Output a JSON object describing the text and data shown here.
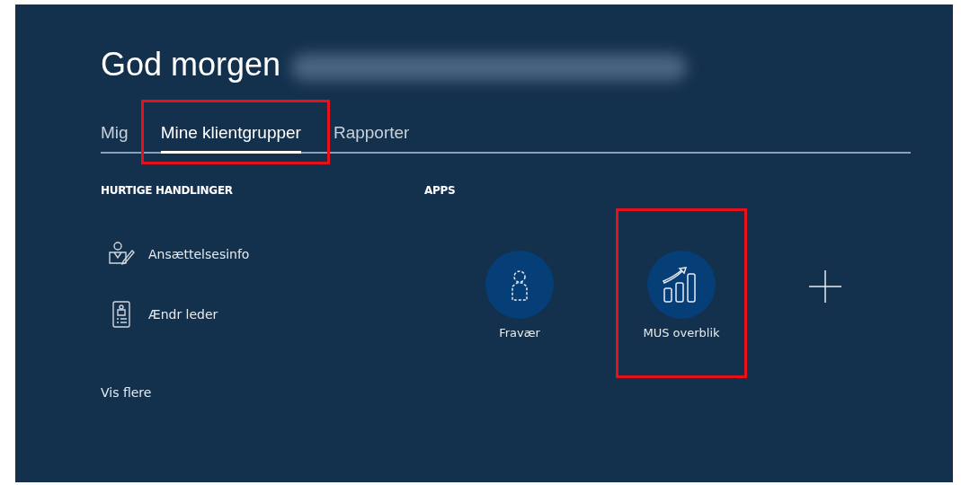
{
  "greeting": "God morgen",
  "tabs": [
    {
      "label": "Mig",
      "selected": false,
      "highlighted": false
    },
    {
      "label": "Mine klientgrupper",
      "selected": true,
      "highlighted": true
    },
    {
      "label": "Rapporter",
      "selected": false,
      "highlighted": false
    }
  ],
  "quick_actions": {
    "heading": "HURTIGE HANDLINGER",
    "items": [
      {
        "label": "Ansættelsesinfo",
        "kind": "person-edit"
      },
      {
        "label": "Ændr leder",
        "kind": "badge"
      }
    ],
    "more_link": "Vis flere"
  },
  "apps": {
    "heading": "APPS",
    "items": [
      {
        "label": "Fravær",
        "kind": "person",
        "highlighted": false
      },
      {
        "label": "MUS overblik",
        "kind": "chart",
        "highlighted": true
      }
    ]
  }
}
